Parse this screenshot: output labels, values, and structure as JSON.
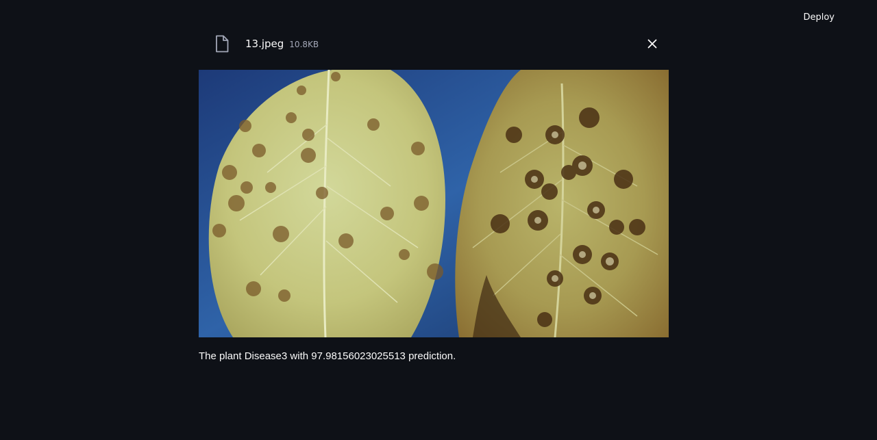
{
  "header": {
    "deploy_label": "Deploy"
  },
  "uploaded_file": {
    "name": "13.jpeg",
    "size": "10.8KB",
    "file_icon": "document-icon",
    "close_icon": "close-icon"
  },
  "image": {
    "alt": "Two apple leaves with brown leaf spots"
  },
  "result": {
    "prediction": "The plant Disease3 with 97.98156023025513 prediction."
  },
  "colors": {
    "background": "#0e1117",
    "text": "#fafafa",
    "muted_text": "#a3a8b8"
  }
}
